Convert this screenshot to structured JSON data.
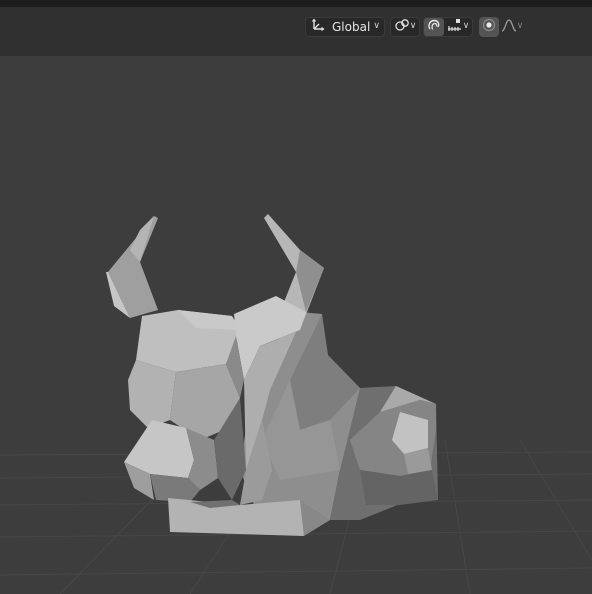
{
  "header": {
    "transform_orientation": {
      "value": "Global",
      "icon": "transform-orientation-axes-icon"
    },
    "pivot_point": {
      "icon": "pivot-point-icon"
    },
    "snapping": {
      "toggle_icon": "snap-magnet-icon",
      "target_icon": "snap-increment-icon",
      "enabled": true
    },
    "proportional_editing": {
      "toggle_icon": "proportional-edit-icon",
      "falloff_icon": "falloff-curve-icon",
      "enabled": true
    }
  },
  "viewport": {
    "object": "low-poly-bull-head-mesh",
    "colors": {
      "background": "#3d3d3d",
      "header": "#303030",
      "grid_line": "#4a4a4a",
      "mesh_light": "#c9c9c9",
      "mesh_mid": "#9c9c9c",
      "mesh_dark": "#5e5e5e"
    }
  }
}
